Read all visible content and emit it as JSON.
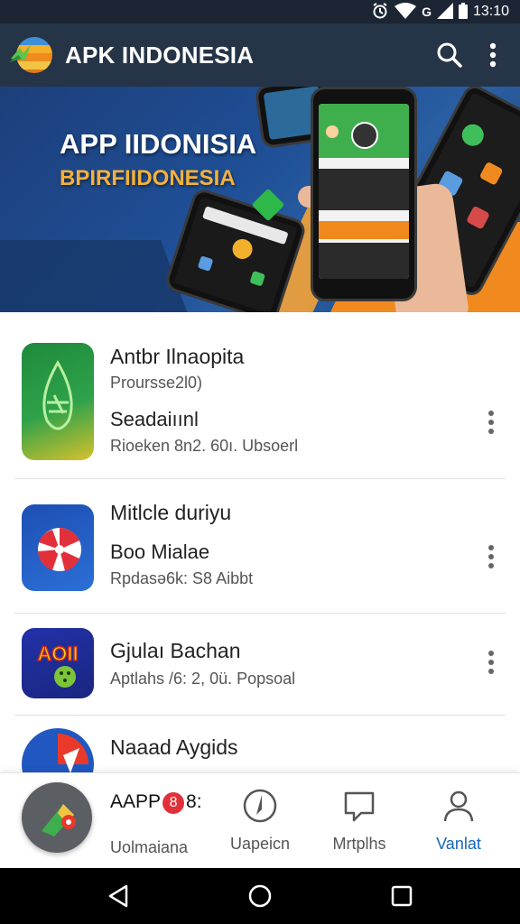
{
  "status_bar": {
    "time": "13:10",
    "network": "G"
  },
  "app_bar": {
    "title": "APK INDONESIA"
  },
  "banner": {
    "title": "APP IIDONISIA",
    "subtitle": "BPIRFIIDONESIA"
  },
  "apps": [
    {
      "title": "Antbr Ilnaopita",
      "line2": "Proursse2l0)",
      "line3": "Seadaiıınl",
      "line4": "Rioeken 8n2. 60ı. Ubsoerl",
      "icon": "green-leaf-app-icon"
    },
    {
      "title": "Mitlcle duriyu",
      "line2": "Boo Mialae",
      "line3": "Rpdasə6k: S8 Aibbt",
      "icon": "red-swirl-app-icon"
    },
    {
      "title": "Gjulaı Bachan",
      "line2": "Aptlahs /6: 2, 0ü. Popsoal",
      "icon": "game-app-icon"
    },
    {
      "title": "Naaad Aygids",
      "icon": "red-shield-app-icon"
    }
  ],
  "bottom_nav": {
    "fab_title": "AAPP",
    "fab_badge": "8",
    "fab_suffix": "8:",
    "fab_label": "Uolmaiana",
    "items": [
      {
        "label": "Uapeicn",
        "icon": "compass-icon"
      },
      {
        "label": "Mrtplhs",
        "icon": "chat-icon"
      },
      {
        "label": "Vanlat",
        "icon": "profile-icon"
      }
    ]
  },
  "colors": {
    "appbar": "#253447",
    "accent": "#1565c0",
    "banner": "#1f4f96",
    "orange": "#f08a1e"
  }
}
